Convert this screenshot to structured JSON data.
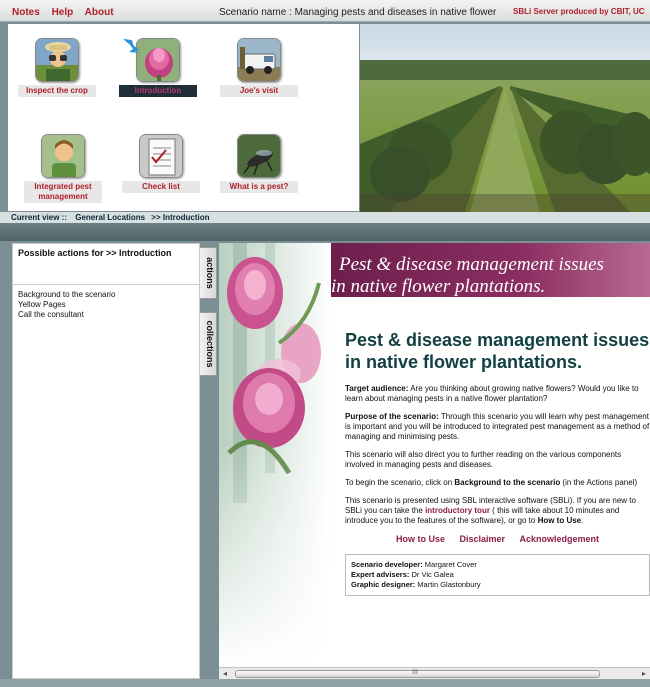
{
  "menu": {
    "notes": "Notes",
    "help": "Help",
    "about": "About"
  },
  "scenario_name": "Scenario name : Managing pests and diseases in native flower",
  "credit": "SBLi Server produced by CBIT, UC",
  "icons": [
    {
      "label": "Inspect the crop"
    },
    {
      "label": "Introduction"
    },
    {
      "label": "Joe's visit"
    },
    {
      "label": "Integrated pest management"
    },
    {
      "label": "Check list"
    },
    {
      "label": "What is a pest?"
    }
  ],
  "breadcrumb": {
    "prefix": "Current view ::",
    "crumb1": "General Locations",
    "crumb2": ">> Introduction"
  },
  "actions_panel": {
    "header": "Possible actions for >> Introduction",
    "items": [
      "Background to the scenario",
      "Yellow Pages",
      "Call the consultant"
    ]
  },
  "tabs": {
    "actions": "actions",
    "collections": "collections"
  },
  "banner": {
    "line1": "Pest & disease management issues",
    "line2": "in native flower plantations."
  },
  "content": {
    "title": "Pest & disease management issues in native flower plantations.",
    "target_label": "Target audience:",
    "target_text": " Are you thinking about growing native flowers? Would you like to learn about managing pests in a native flower plantation?",
    "purpose_label": "Purpose of the scenario:",
    "purpose_text": " Through this scenario you will learn why pest management is important and you will be introduced to integrated pest management as a method of managing and minimising pests.",
    "para3": "This scenario will also direct you to further reading on the various components involved in managing pests and diseases.",
    "para4_a": "To begin the scenario, click on ",
    "para4_b": "Background to the scenario",
    "para4_c": " (in the Actions panel)",
    "para5_a": "This scenario is presented using SBL interactive software (SBLi). If you are new to SBLi you can take the ",
    "para5_link": "introductory tour",
    "para5_b": " ( this will take about 10 minutes and introduce you to the features of the software), or go to ",
    "para5_c": "How to Use",
    "para5_d": ".",
    "links": [
      "How to Use",
      "Disclaimer",
      "Acknowledgement"
    ],
    "credits": [
      {
        "label": "Scenario developer:",
        "value": " Margaret Cover"
      },
      {
        "label": "Expert advisers:",
        "value": " Dr Vic Galea"
      },
      {
        "label": "Graphic designer:",
        "value": " Martin Glastonbury"
      }
    ]
  },
  "scroll": {
    "left": "◂",
    "right": "▸",
    "grip": "III"
  }
}
